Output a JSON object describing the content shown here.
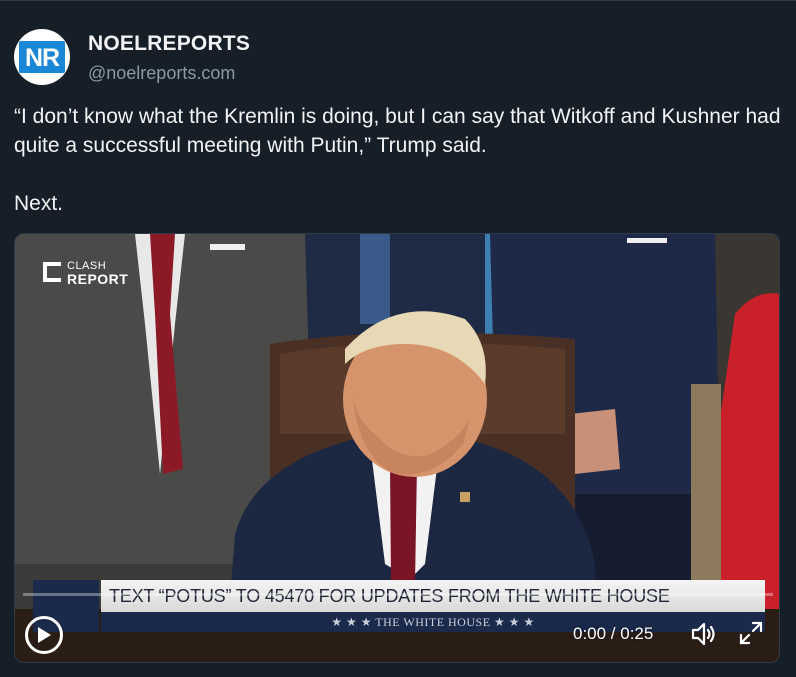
{
  "author": {
    "avatar_text": "NR",
    "display_name": "NOELREPORTS",
    "handle": "@noelreports.com"
  },
  "post": {
    "text": "“I don’t know what the Kremlin is doing, but I can say that Witkoff and Kushner had quite a successful meeting with Putin,” Trump said.\n\nNext."
  },
  "video": {
    "watermark_line1": "CLASH",
    "watermark_line2": "REPORT",
    "chyron": "TEXT “POTUS” TO 45470 FOR UPDATES FROM THE WHITE HOUSE",
    "chyron_sub": "★ ★ ★   THE WHITE HOUSE   ★ ★ ★",
    "time": "0:00 / 0:25",
    "progress": 0,
    "controls": {
      "play_icon": "play-icon",
      "volume_icon": "volume-icon",
      "fullscreen_icon": "fullscreen-icon"
    }
  },
  "colors": {
    "background": "#161e27",
    "text": "#f1f3f5",
    "secondary_text": "#8b98a5",
    "avatar_brand": "#1a86d6"
  }
}
